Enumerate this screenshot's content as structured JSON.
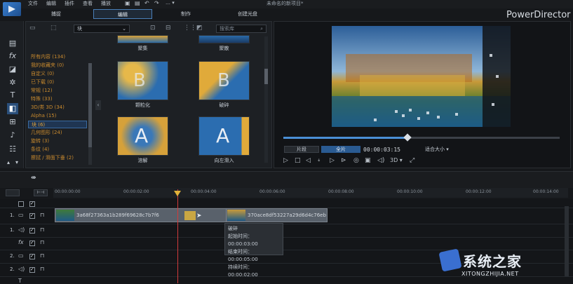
{
  "menubar": {
    "items": [
      "文件",
      "编辑",
      "插件",
      "查看",
      "播放"
    ],
    "doc_title": "未命名的新项目*",
    "app_name": "PowerDirector"
  },
  "modes": {
    "capture": "捕捉",
    "edit": "编辑",
    "produce": "制作",
    "disc": "创建光盘"
  },
  "library": {
    "category_value": "块",
    "search_placeholder": "搜索库"
  },
  "categories": [
    "所有内容 (134)",
    "我的收藏夹 (0)",
    "自定义 (0)",
    "已下载 (0)",
    "常规 (12)",
    "特殊 (33)",
    "3D/类 3D (34)",
    "Alpha (15)",
    "块 (6)",
    "几何图形 (24)",
    "旋转 (3)",
    "条纹 (4)",
    "擦拭 / 滑面下垂 (2)"
  ],
  "thumbs": [
    {
      "label": "聚集"
    },
    {
      "label": "聚散"
    },
    {
      "label": "颗粒化"
    },
    {
      "label": "破碎"
    },
    {
      "label": "溶解"
    },
    {
      "label": "向左滑入"
    }
  ],
  "preview": {
    "clip": "片段",
    "movie": "全片",
    "timecode": "00:00:03:15",
    "fit": "适合大小",
    "mode3d": "3D"
  },
  "ruler": [
    "00:00:00:00",
    "00:00:02:00",
    "00:00:04:00",
    "00:00:06:00",
    "00:00:08:00",
    "00:00:10:00",
    "00:00:12:00",
    "00:00:14:00"
  ],
  "tracks": {
    "video1": "1.",
    "audio1": "1.",
    "fx": "fx",
    "video2": "2.",
    "audio2": "2."
  },
  "clips": {
    "clip1": "3a68f27363a1b289f69628c7b7f6",
    "clip2": "370ace8df53227a29d6d4c76ebac"
  },
  "tooltip": {
    "title": "破碎",
    "start": "起始时间：00:00:03:00",
    "end": "结束时间：00:00:05:00",
    "duration": "持续时间：00:00:02:00"
  },
  "watermark": {
    "main": "系统之家",
    "sub": "XITONGZHIJIA.NET"
  },
  "colors": {
    "accent": "#4a8fd6",
    "playhead": "#d23b3b",
    "category_text": "#c98a2e"
  }
}
